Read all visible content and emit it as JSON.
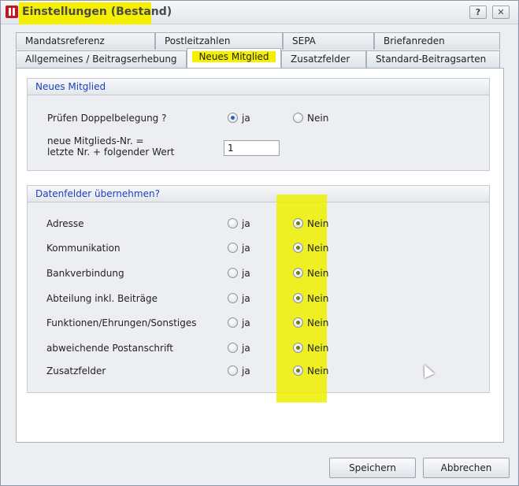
{
  "window": {
    "title": "Einstellungen (Bestand)",
    "help_label": "?",
    "close_label": "✕"
  },
  "tabs": {
    "row1": [
      {
        "label": "Mandatsreferenz"
      },
      {
        "label": "Postleitzahlen"
      },
      {
        "label": "SEPA"
      },
      {
        "label": "Briefanreden"
      }
    ],
    "row2": [
      {
        "label": "Allgemeines / Beitragserhebung"
      },
      {
        "label": "Neues Mitglied",
        "active": true
      },
      {
        "label": "Zusatzfelder"
      },
      {
        "label": "Standard-Beitragsarten"
      }
    ]
  },
  "group_new_member": {
    "title": "Neues Mitglied",
    "duplicate_check_label": "Prüfen Doppelbelegung ?",
    "yes_label": "ja",
    "no_label": "Nein",
    "duplicate_check_value": "ja",
    "next_number_label_line1": "neue Mitglieds-Nr. =",
    "next_number_label_line2": "letzte Nr. + folgender Wert",
    "next_number_value": "1"
  },
  "group_fields": {
    "title": "Datenfelder übernehmen?",
    "yes_label": "ja",
    "no_label": "Nein",
    "rows": [
      {
        "label": "Adresse",
        "value": "Nein"
      },
      {
        "label": "Kommunikation",
        "value": "Nein"
      },
      {
        "label": "Bankverbindung",
        "value": "Nein"
      },
      {
        "label": "Abteilung inkl. Beiträge",
        "value": "Nein"
      },
      {
        "label": "Funktionen/Ehrungen/Sonstiges",
        "value": "Nein"
      },
      {
        "label": "abweichende Postanschrift",
        "value": "Nein"
      },
      {
        "label": "Zusatzfelder",
        "value": "Nein"
      }
    ]
  },
  "footer": {
    "save_label": "Speichern",
    "cancel_label": "Abbrechen"
  },
  "colors": {
    "highlight": "#f4f000",
    "group_title": "#1c3fbf",
    "app_icon": "#c8141c"
  }
}
